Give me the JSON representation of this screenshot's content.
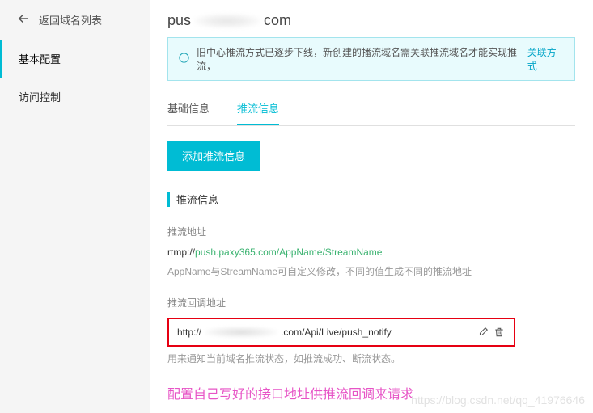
{
  "sidebar": {
    "back_label": "返回域名列表",
    "items": [
      {
        "label": "基本配置",
        "active": true
      },
      {
        "label": "访问控制",
        "active": false
      }
    ]
  },
  "header": {
    "title_prefix": "pus",
    "title_suffix": "com"
  },
  "notice": {
    "text": "旧中心推流方式已逐步下线，新创建的播流域名需关联推流域名才能实现推流，",
    "link_text": "关联方式"
  },
  "tabs": [
    {
      "label": "基础信息",
      "active": false
    },
    {
      "label": "推流信息",
      "active": true
    }
  ],
  "actions": {
    "add_push_label": "添加推流信息"
  },
  "section": {
    "title": "推流信息",
    "push_addr": {
      "label": "推流地址",
      "prefix": "rtmp://",
      "value_green": "push.paxy365.com/AppName/StreamName",
      "hint": "AppName与StreamName可自定义修改，不同的值生成不同的推流地址"
    },
    "callback": {
      "label": "推流回调地址",
      "prefix": "http://",
      "suffix": ".com/Api/Live/push_notify",
      "hint": "用来通知当前域名推流状态，如推流成功、断流状态。"
    }
  },
  "annotation": "配置自己写好的接口地址供推流回调来请求",
  "watermark": "https://blog.csdn.net/qq_41976646"
}
